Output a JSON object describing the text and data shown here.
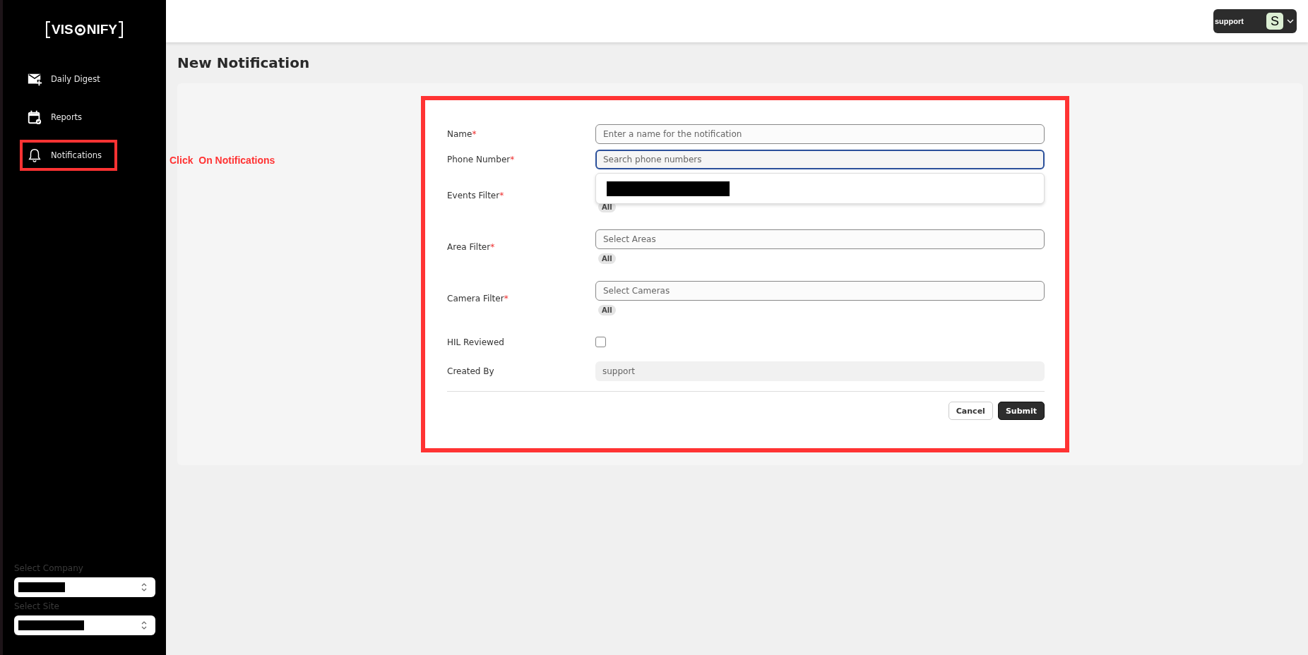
{
  "logo": {
    "left": "VIS",
    "right": "NIFY"
  },
  "sidebar": {
    "items": [
      {
        "label": "Daily Digest",
        "kind": "mail",
        "annotated": false
      },
      {
        "label": "Reports",
        "kind": "calendar",
        "annotated": false
      },
      {
        "label": "Notifications",
        "kind": "bell",
        "annotated": true
      }
    ],
    "selects": [
      {
        "label": "Select Company",
        "redacted": true
      },
      {
        "label": "Select Site",
        "redacted": true
      }
    ]
  },
  "header": {
    "user": "support",
    "avatar": "S"
  },
  "page_title": "New Notification",
  "annotation": "Click  On Notifications",
  "form": {
    "fields": [
      {
        "label": "Name",
        "required_mark": "*",
        "kind": "text",
        "placeholder": "Enter a name for the notification",
        "focused": false
      },
      {
        "label": "Phone Number",
        "required_mark": "*",
        "kind": "text",
        "placeholder": "Search phone numbers",
        "focused": true,
        "dropdown": {
          "redacted": true
        }
      },
      {
        "label": "Events Filter",
        "required_mark": "*",
        "kind": "multiselect",
        "chips": [
          "All"
        ]
      },
      {
        "label": "Area Filter",
        "required_mark": "*",
        "kind": "multiselect",
        "placeholder": "Select Areas",
        "chips": [
          "All"
        ]
      },
      {
        "label": "Camera Filter",
        "required_mark": "*",
        "kind": "multiselect",
        "placeholder": "Select Cameras",
        "chips": [
          "All"
        ]
      },
      {
        "label": "HIL Reviewed",
        "kind": "checkbox",
        "checked": false
      },
      {
        "label": "Created By",
        "kind": "readonly",
        "value": "support"
      }
    ],
    "buttons": [
      {
        "label": "Cancel",
        "kind": "secondary"
      },
      {
        "label": "Submit",
        "kind": "primary"
      }
    ]
  }
}
